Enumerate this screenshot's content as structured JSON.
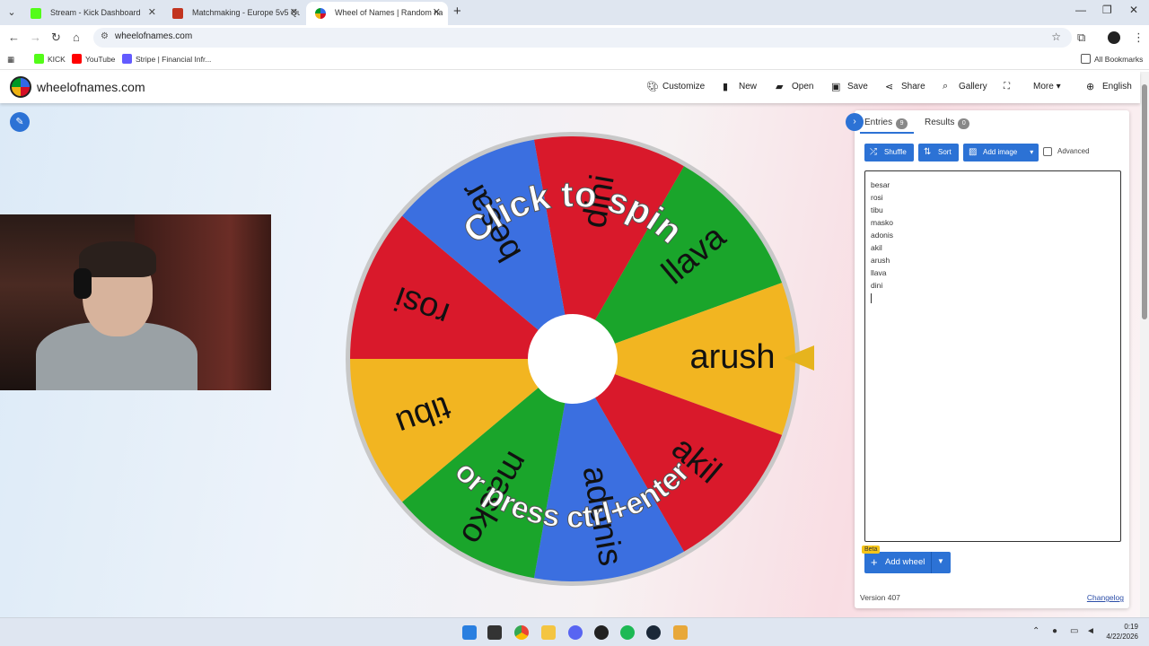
{
  "browser": {
    "tabs": [
      {
        "title": "Stream - Kick Dashboard",
        "favicon_color": "#53fc18",
        "active": false
      },
      {
        "title": "Matchmaking - Europe 5v5 Qu",
        "favicon_color": "#c2341f",
        "active": false
      },
      {
        "title": "Wheel of Names | Random nan",
        "favicon_color": "#3369e8",
        "active": true
      }
    ],
    "url": "wheelofnames.com",
    "bookmarks": [
      {
        "label": "KICK",
        "color": "#53fc18"
      },
      {
        "label": "YouTube",
        "color": "#ff0000"
      },
      {
        "label": "Stripe | Financial Infr...",
        "color": "#635bff"
      }
    ],
    "all_bookmarks": "All Bookmarks"
  },
  "app": {
    "name": "wheelofnames.com",
    "menu": [
      {
        "label": "Customize",
        "icon": "palette-icon"
      },
      {
        "label": "New",
        "icon": "file-icon"
      },
      {
        "label": "Open",
        "icon": "folder-open-icon"
      },
      {
        "label": "Save",
        "icon": "save-icon"
      },
      {
        "label": "Share",
        "icon": "share-icon"
      },
      {
        "label": "Gallery",
        "icon": "search-icon"
      },
      {
        "label": "",
        "icon": "fullscreen-icon"
      },
      {
        "label": "More",
        "icon": "chevron-down-icon"
      },
      {
        "label": "English",
        "icon": "globe-icon"
      }
    ]
  },
  "wheel": {
    "click_text": "Click to spin",
    "press_text": "or press ctrl+enter",
    "segments": [
      {
        "label": "dini",
        "color": "#d9192b"
      },
      {
        "label": "llava",
        "color": "#1aa52b"
      },
      {
        "label": "arush",
        "color": "#f2b521"
      },
      {
        "label": "akil",
        "color": "#d9192b"
      },
      {
        "label": "adonis",
        "color": "#3b6fe0"
      },
      {
        "label": "masko",
        "color": "#1aa52b"
      },
      {
        "label": "tibu",
        "color": "#f2b521"
      },
      {
        "label": "rosi",
        "color": "#d9192b"
      },
      {
        "label": "besar",
        "color": "#3b6fe0"
      }
    ]
  },
  "panel": {
    "tab_entries": "Entries",
    "entries_count": "9",
    "tab_results": "Results",
    "results_count": "0",
    "shuffle": "Shuffle",
    "sort": "Sort",
    "add_image": "Add image",
    "advanced": "Advanced",
    "entries": [
      "besar",
      "rosi",
      "tibu",
      "masko",
      "adonis",
      "akil",
      "arush",
      "llava",
      "dini"
    ],
    "beta": "Beta",
    "add_wheel": "Add wheel",
    "version": "Version 407",
    "changelog": "Changelog"
  },
  "taskbar": {
    "time": "0:19",
    "date": "4/22/2026"
  }
}
